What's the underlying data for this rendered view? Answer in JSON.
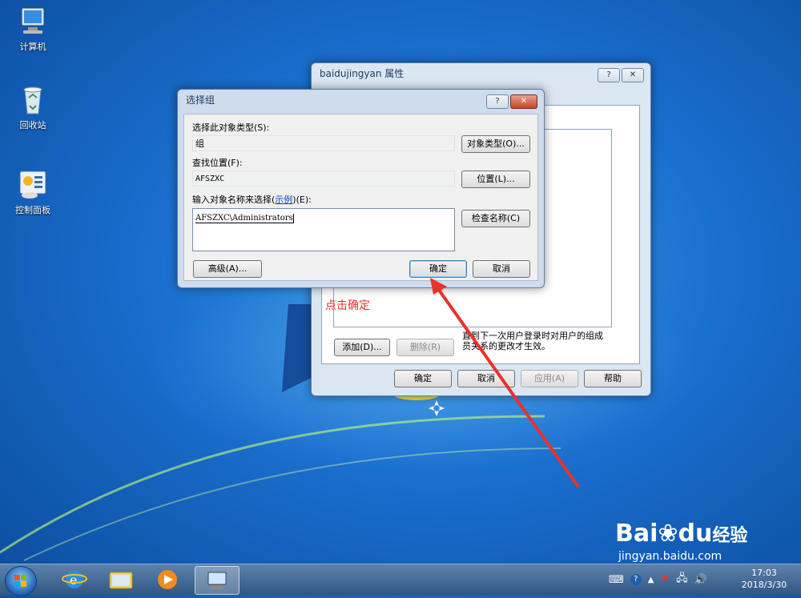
{
  "desktop": {
    "icons": [
      {
        "label": "计算机",
        "icon": "computer-icon"
      },
      {
        "label": "回收站",
        "icon": "recycle-bin-icon"
      },
      {
        "label": "控制面板",
        "icon": "control-panel-icon"
      }
    ]
  },
  "properties_window": {
    "title": "baidujingyan 属性",
    "help_btn": "?",
    "close_btn": "✕",
    "add_btn": "添加(D)...",
    "remove_btn": "删除(R)",
    "note": "直到下一次用户登录时对用户的组成员关系的更改才生效。",
    "ok_btn": "确定",
    "cancel_btn": "取消",
    "apply_btn": "应用(A)",
    "help_footer_btn": "帮助"
  },
  "select_group_dialog": {
    "title": "选择组",
    "help_btn": "?",
    "close_btn": "✕",
    "object_type_label": "选择此对象类型(S):",
    "object_type_value": "组",
    "object_type_btn": "对象类型(O)...",
    "location_label": "查找位置(F):",
    "location_value": "AFSZXC",
    "location_btn": "位置(L)...",
    "names_label_prefix": "输入对象名称来选择(",
    "names_label_link": "示例",
    "names_label_suffix": ")(E):",
    "names_value": "AFSZXC\\Administrators",
    "check_names_btn": "检查名称(C)",
    "advanced_btn": "高级(A)...",
    "ok_btn": "确定",
    "cancel_btn": "取消"
  },
  "annotation": {
    "text": "点击确定",
    "color": "#e8322b"
  },
  "taskbar": {
    "clock_time": "17:03",
    "clock_date": "2018/3/30",
    "items": [
      "start-button",
      "ie-icon",
      "explorer-icon",
      "media-player-icon",
      "computer-mgmt-icon"
    ]
  },
  "watermark": {
    "brand": "Bai",
    "brand2": "du",
    "suffix": "经验",
    "url": "jingyan.baidu.com"
  }
}
